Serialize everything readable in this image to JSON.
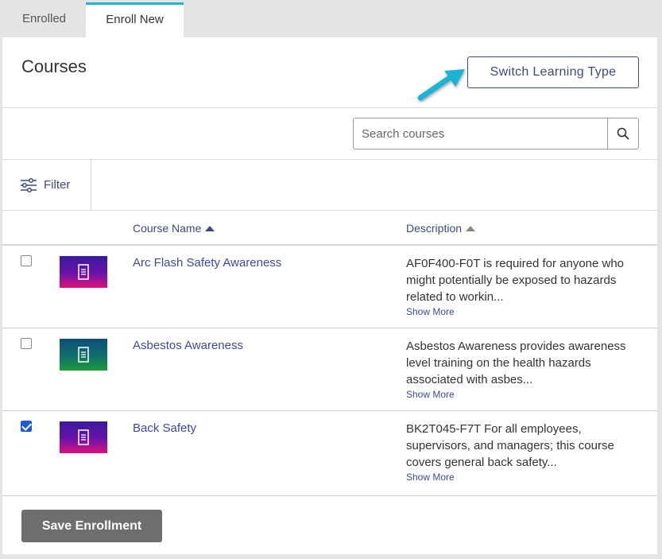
{
  "tabs": [
    {
      "label": "Enrolled",
      "active": false
    },
    {
      "label": "Enroll New",
      "active": true
    }
  ],
  "header": {
    "title": "Courses",
    "switch_button_label": "Switch Learning Type"
  },
  "search": {
    "placeholder": "Search courses",
    "value": ""
  },
  "filter": {
    "label": "Filter"
  },
  "table": {
    "columns": [
      {
        "label": "Course Name",
        "sort": "ascending"
      },
      {
        "label": "Description",
        "sort": "ascending"
      }
    ],
    "rows": [
      {
        "checked": false,
        "name": "Arc Flash Safety Awareness",
        "description": "AF0F400-F0T is required for anyone who might potentially be exposed to hazards related to workin...",
        "show_more": "Show More",
        "thumb_colors": [
          "#3a1aa0",
          "#e0107a"
        ]
      },
      {
        "checked": false,
        "name": "Asbestos Awareness",
        "description": "Asbestos Awareness provides awareness level training on the health hazards associated with asbes...",
        "show_more": "Show More",
        "thumb_colors": [
          "#0e4f7a",
          "#1f9a3a"
        ]
      },
      {
        "checked": true,
        "name": "Back Safety",
        "description": "BK2T045-F7T For all employees, supervisors, and managers; this course covers general back safety...",
        "show_more": "Show More",
        "thumb_colors": [
          "#3a1aa0",
          "#e0107a"
        ]
      }
    ]
  },
  "footer": {
    "save_label": "Save Enrollment"
  },
  "colors": {
    "accent": "#1fb4d6",
    "link": "#3d4a9a",
    "save_button": "#6e6e6e"
  }
}
